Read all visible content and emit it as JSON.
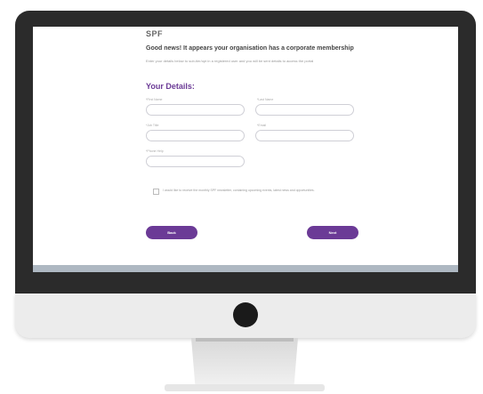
{
  "page": {
    "logo": "SPF",
    "headline": "Good news! It appears your organisation has a corporate membership",
    "subtext": "Enter your details below to sub-tier/opt in a registered user and you will be sent details to access the portal",
    "details_title": "Your Details:"
  },
  "form": {
    "first_name_label": "*First Name",
    "last_name_label": "*Last Name",
    "job_title_label": "*Job Title",
    "email_label": "*Email",
    "phone_label": "*Phone Help",
    "consent_text": "I would like to receive the monthly SPF newsletter, containing upcoming events, latest news and opportunities."
  },
  "buttons": {
    "back": "Back",
    "next": "Next"
  },
  "colors": {
    "accent": "#6b3a96",
    "frame": "#2b2b2b"
  }
}
